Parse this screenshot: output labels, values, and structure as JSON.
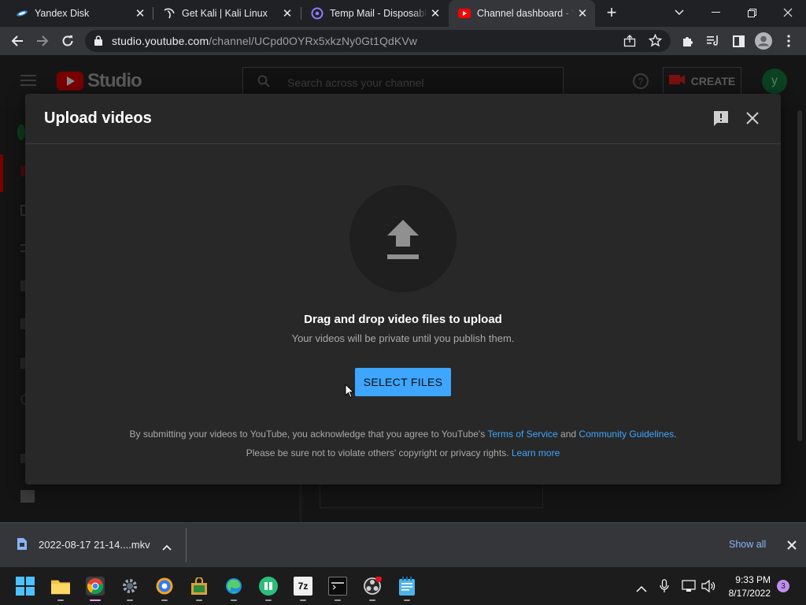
{
  "browser": {
    "tabs": [
      {
        "title": "Yandex Disk",
        "icon": "yandex-disk-icon"
      },
      {
        "title": "Get Kali | Kali Linux",
        "icon": "kali-icon"
      },
      {
        "title": "Temp Mail - Disposable",
        "icon": "temp-mail-icon"
      },
      {
        "title": "Channel dashboard - YouTube",
        "icon": "youtube-icon",
        "active": true
      }
    ],
    "url_host": "studio.youtube.com",
    "url_path": "/channel/UCpd0OYRx5xkzNy0Gt1QdKVw"
  },
  "studio": {
    "logo_text": "Studio",
    "search_placeholder": "Search across your channel",
    "create_label": "CREATE",
    "avatar_letter": "y"
  },
  "dialog": {
    "title": "Upload videos",
    "drag_title": "Drag and drop video files to upload",
    "drag_subtitle": "Your videos will be private until you publish them.",
    "select_button": "SELECT FILES",
    "legal_prefix": "By submitting your videos to YouTube, you acknowledge that you agree to YouTube's",
    "terms_link": "Terms of Service",
    "and_text": "and",
    "guidelines_link": "Community Guidelines",
    "period": ".",
    "rights_text": "Please be sure not to violate others' copyright or privacy rights.",
    "learn_more": "Learn more"
  },
  "download_bar": {
    "file_name": "2022-08-17 21-14....mkv",
    "show_all": "Show all"
  },
  "taskbar": {
    "time": "9:33 PM",
    "date": "8/17/2022",
    "notification_count": "3",
    "seven_zip_label": "7z"
  },
  "colors": {
    "accent": "#3ea6ff",
    "youtube_red": "#ff0000",
    "dialog_bg": "#282828",
    "avatar_green": "#0b8043"
  }
}
